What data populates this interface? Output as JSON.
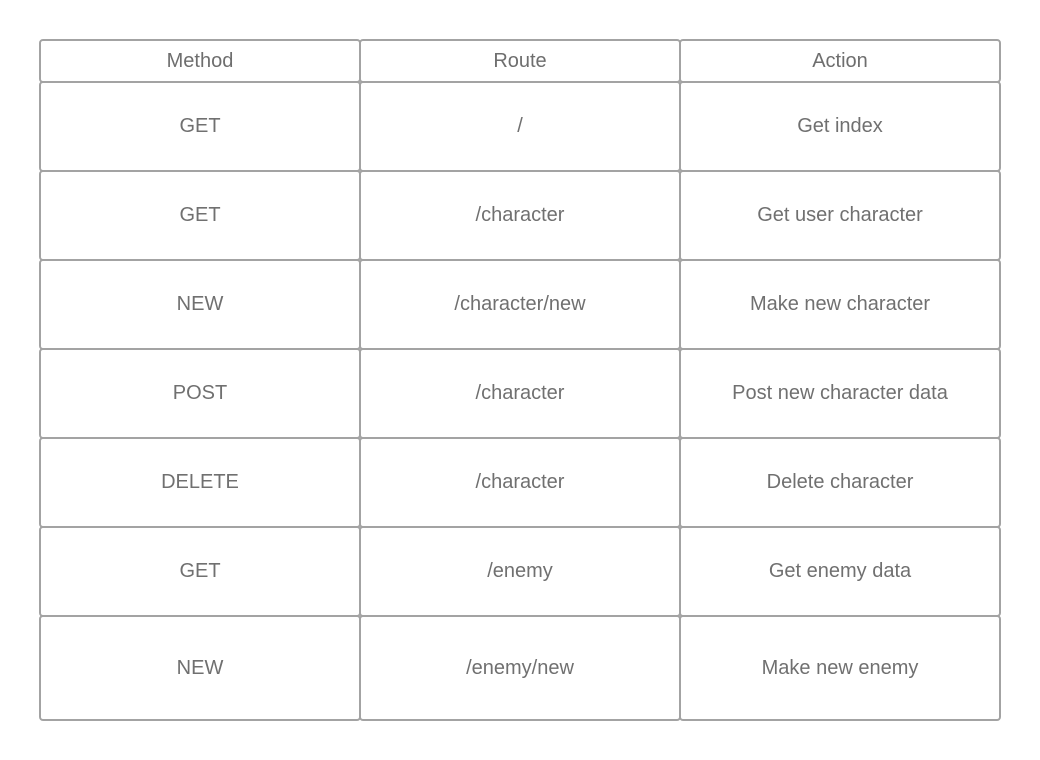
{
  "table": {
    "headers": [
      "Method",
      "Route",
      "Action"
    ],
    "rows": [
      [
        "GET",
        "/",
        "Get index"
      ],
      [
        "GET",
        "/character",
        "Get user character"
      ],
      [
        "NEW",
        "/character/new",
        "Make new character"
      ],
      [
        "POST",
        "/character",
        "Post new character data"
      ],
      [
        "DELETE",
        "/character",
        "Delete character"
      ],
      [
        "GET",
        "/enemy",
        "Get enemy data"
      ],
      [
        "NEW",
        "/enemy/new",
        "Make new enemy"
      ]
    ]
  },
  "colors": {
    "border": "#a3a3a3",
    "text": "#707070",
    "background": "#ffffff"
  }
}
